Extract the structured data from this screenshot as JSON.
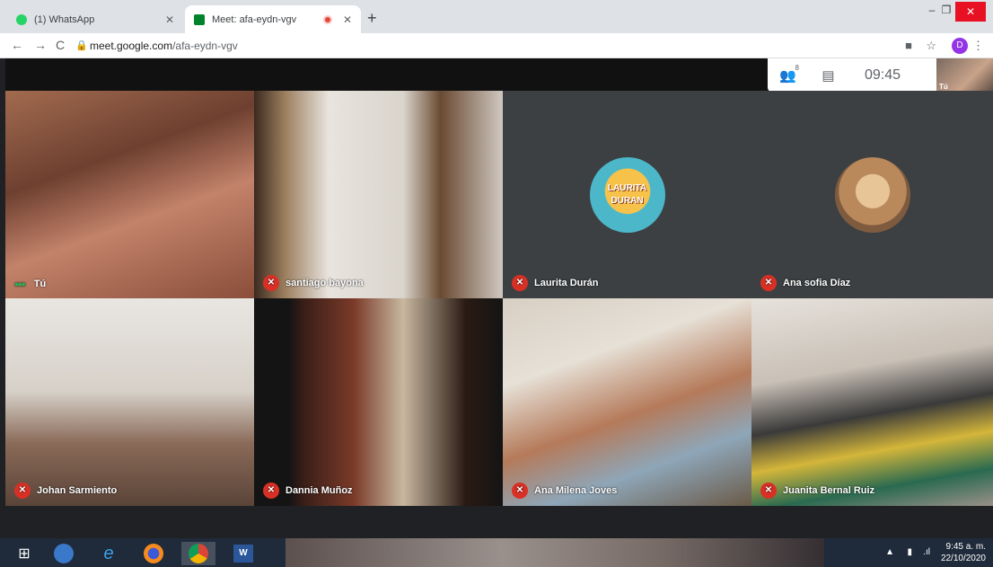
{
  "browser": {
    "tabs": [
      {
        "title": "(1) WhatsApp",
        "active": false
      },
      {
        "title": "Meet: afa-eydn-vgv",
        "active": true
      }
    ],
    "url_host": "meet.google.com",
    "url_path": "/afa-eydn-vgv",
    "profile_initial": "D",
    "window_controls": {
      "minimize": "–",
      "maximize": "❐",
      "close": "✕"
    }
  },
  "meet": {
    "participants_count": "8",
    "time": "09:45",
    "self_thumb_label": "Tú",
    "tiles": [
      {
        "name": "Tú",
        "muted": false
      },
      {
        "name": "santiago bayona",
        "muted": true
      },
      {
        "name": "Laurita Durán",
        "muted": true
      },
      {
        "name": "Ana sofia Díaz",
        "muted": true
      },
      {
        "name": "Johan Sarmiento",
        "muted": true
      },
      {
        "name": "Dannia Muñoz",
        "muted": true
      },
      {
        "name": "Ana Milena Joves",
        "muted": true
      },
      {
        "name": "Juanita Bernal Ruiz",
        "muted": true
      }
    ],
    "laurita_avatar_text_1": "LAURITA",
    "laurita_avatar_text_2": "DURAN"
  },
  "taskbar": {
    "time": "9:45 a. m.",
    "date": "22/10/2020"
  }
}
